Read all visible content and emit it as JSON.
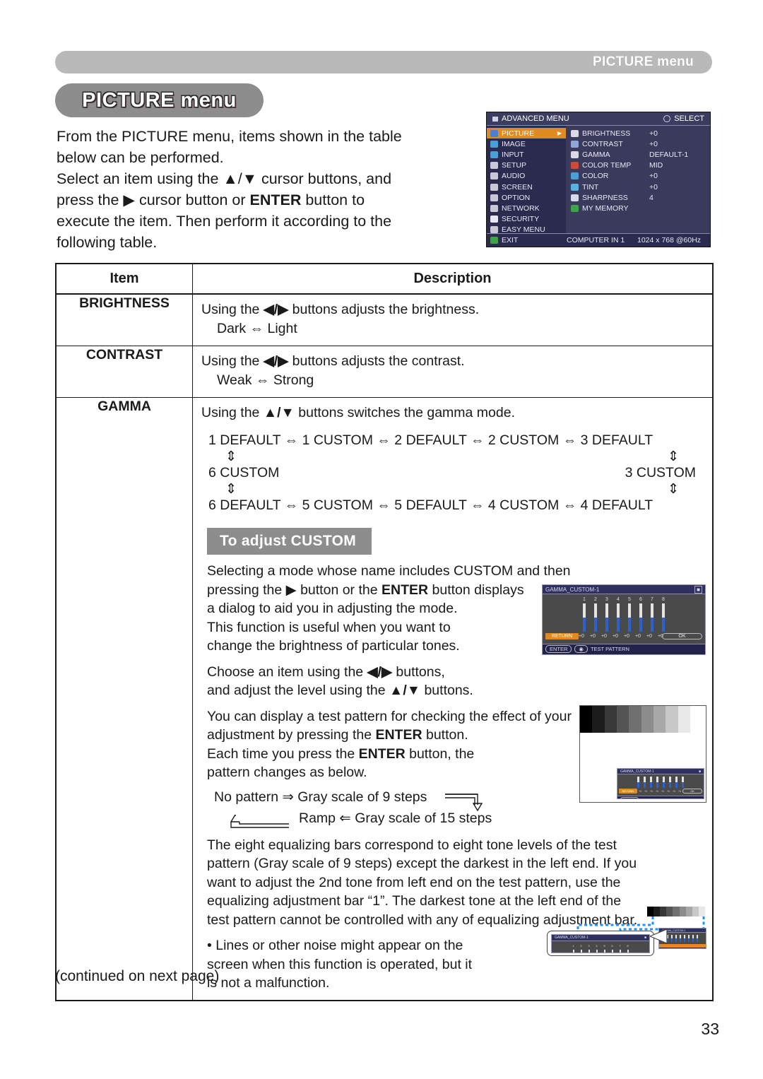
{
  "running_header": {
    "text": "PICTURE menu"
  },
  "page_title": {
    "text": "PICTURE menu"
  },
  "intro": {
    "line1": "From the PICTURE menu, items shown in the table",
    "line2": "below can be performed.",
    "line3a": "Select an item using the ",
    "line3b": "▲/▼",
    "line3c": " cursor buttons, and",
    "line4a": "press the ",
    "line4b": "▶",
    "line4c": " cursor button or ",
    "line4d": "ENTER",
    "line4e": " button to",
    "line5": "execute the item. Then perform it according to the",
    "line6": "following table."
  },
  "osd": {
    "title": "ADVANCED MENU",
    "select_label": "SELECT",
    "left_items": [
      {
        "label": "PICTURE",
        "color": "#4a7fd4",
        "selected": true,
        "arrow": "▶"
      },
      {
        "label": "IMAGE",
        "color": "#4a9fd4",
        "selected": false,
        "arrow": ""
      },
      {
        "label": "INPUT",
        "color": "#4a9fd4",
        "selected": false,
        "arrow": ""
      },
      {
        "label": "SETUP",
        "color": "#c8c8d8",
        "selected": false,
        "arrow": ""
      },
      {
        "label": "AUDIO",
        "color": "#c8c8d8",
        "selected": false,
        "arrow": ""
      },
      {
        "label": "SCREEN",
        "color": "#c8c8d8",
        "selected": false,
        "arrow": ""
      },
      {
        "label": "OPTION",
        "color": "#c8c8d8",
        "selected": false,
        "arrow": ""
      },
      {
        "label": "NETWORK",
        "color": "#c8c8d8",
        "selected": false,
        "arrow": ""
      },
      {
        "label": "SECURITY",
        "color": "#e8e8f5",
        "selected": false,
        "arrow": ""
      },
      {
        "label": "EASY MENU",
        "color": "#c8c8d8",
        "selected": false,
        "arrow": ""
      },
      {
        "label": "EXIT",
        "color": "#3fa34a",
        "selected": false,
        "arrow": ""
      }
    ],
    "right_items": [
      {
        "label": "BRIGHTNESS",
        "value": "+0",
        "color": "#d8d8e8"
      },
      {
        "label": "CONTRAST",
        "value": "+0",
        "color": "#8fa8d8"
      },
      {
        "label": "GAMMA",
        "value": "DEFAULT-1",
        "color": "#d8d8e8"
      },
      {
        "label": "COLOR TEMP",
        "value": "MID",
        "color": "#d04a3a"
      },
      {
        "label": "COLOR",
        "value": "+0",
        "color": "#4a9fd4"
      },
      {
        "label": "TINT",
        "value": "+0",
        "color": "#5ab0e0"
      },
      {
        "label": "SHARPNESS",
        "value": "4",
        "color": "#d8d8e8"
      },
      {
        "label": "MY MEMORY",
        "value": "",
        "color": "#3fa34a"
      }
    ],
    "footer_source": "COMPUTER IN 1",
    "footer_mode": "1024 x 768 @60Hz"
  },
  "table": {
    "headers": {
      "item": "Item",
      "description": "Description"
    },
    "brightness": {
      "name": "BRIGHTNESS",
      "desc_line1a": "Using the ",
      "desc_line1b": "◀/▶",
      "desc_line1c": " buttons adjusts the brightness.",
      "desc_line2": "Dark ⇔ Light"
    },
    "contrast": {
      "name": "CONTRAST",
      "desc_line1a": "Using the ",
      "desc_line1b": "◀/▶",
      "desc_line1c": " buttons adjusts the contrast.",
      "desc_line2": "Weak ⇔ Strong"
    },
    "gamma": {
      "name": "GAMMA",
      "intro_a": "Using the ",
      "intro_b": "▲/▼",
      "intro_c": " buttons switches the gamma mode.",
      "cycle_top": "1 DEFAULT ⇔ 1 CUSTOM ⇔ 2 DEFAULT ⇔ 2 CUSTOM  ⇔ 3 DEFAULT",
      "cycle_mid_left": "6 CUSTOM",
      "cycle_mid_right": "3 CUSTOM",
      "cycle_bottom": "6 DEFAULT ⇔ 5 CUSTOM ⇔ 5 DEFAULT ⇔ 4 CUSTOM  ⇔ 4 DEFAULT",
      "vert_arrow": "⇕",
      "banner": "To adjust CUSTOM",
      "p1_l1": "Selecting a mode whose name includes CUSTOM and then",
      "p1_l2a": "pressing the ",
      "p1_l2b": "▶",
      "p1_l2c": " button or the ",
      "p1_l2d": "ENTER",
      "p1_l2e": " button displays",
      "p1_l3": "a dialog to aid you in adjusting the mode.",
      "p1_l4": "This function is useful when you want to",
      "p1_l5": "change the brightness of particular tones.",
      "p2_l1a": "Choose an item using the ",
      "p2_l1b": "◀/▶",
      "p2_l1c": " buttons,",
      "p2_l2a": "and  adjust the level using the ",
      "p2_l2b": "▲/▼",
      "p2_l2c": " buttons.",
      "p3_l1": "You can display a test pattern for checking the effect of your",
      "p3_l2a": "adjustment by pressing the ",
      "p3_l2b": "ENTER",
      "p3_l2c": " button.",
      "p3_l3a": "Each time you press the ",
      "p3_l3b": "ENTER",
      "p3_l3c": " button, the",
      "p3_l4": "pattern changes as below.",
      "flow_l1": "No pattern ⇒ Gray scale of 9 steps",
      "flow_l2": "Ramp ⇐ Gray scale of 15 steps",
      "p4_l1": "The eight equalizing bars correspond to eight tone levels of the test",
      "p4_l2": "pattern (Gray scale of 9 steps) except the darkest in the left end. If you",
      "p4_l3": "want to adjust the 2nd tone from left end on the test pattern, use the",
      "p4_l4": "equalizing adjustment bar “1”. The darkest tone at the left end of the",
      "p4_l5": "test pattern cannot be controlled with any of equalizing adjustment bar.",
      "p5_l1": "• Lines or other noise might appear on the",
      "p5_l2": "screen when this function is operated, but it",
      "p5_l3": "is not a malfunction."
    }
  },
  "gamma_dialog": {
    "title": "GAMMA_CUSTOM-1",
    "bar_numbers": [
      "1",
      "2",
      "3",
      "4",
      "5",
      "6",
      "7",
      "8"
    ],
    "bar_values": [
      "+0",
      "+0",
      "+0",
      "+0",
      "+0",
      "+0",
      "+0",
      "+0"
    ],
    "return_label": "RETURN",
    "ok_label": "OK",
    "enter_label": "ENTER",
    "test_pattern_label": "TEST PATTERN"
  },
  "test_pattern": {
    "steps": [
      "#000000",
      "#1c1c1c",
      "#383838",
      "#545454",
      "#707070",
      "#8c8c8c",
      "#a8a8a8",
      "#c8c8c8",
      "#e8e8e8"
    ]
  },
  "footer": {
    "continued": "(continued on next page)",
    "page_number": "33"
  },
  "colors": {
    "accent_orange": "#e08a22",
    "osd_blue": "#2b62d0",
    "banner_gray": "#8d8d8d",
    "header_gray": "#b9b9b9",
    "dash_blue": "#1e90ff"
  }
}
